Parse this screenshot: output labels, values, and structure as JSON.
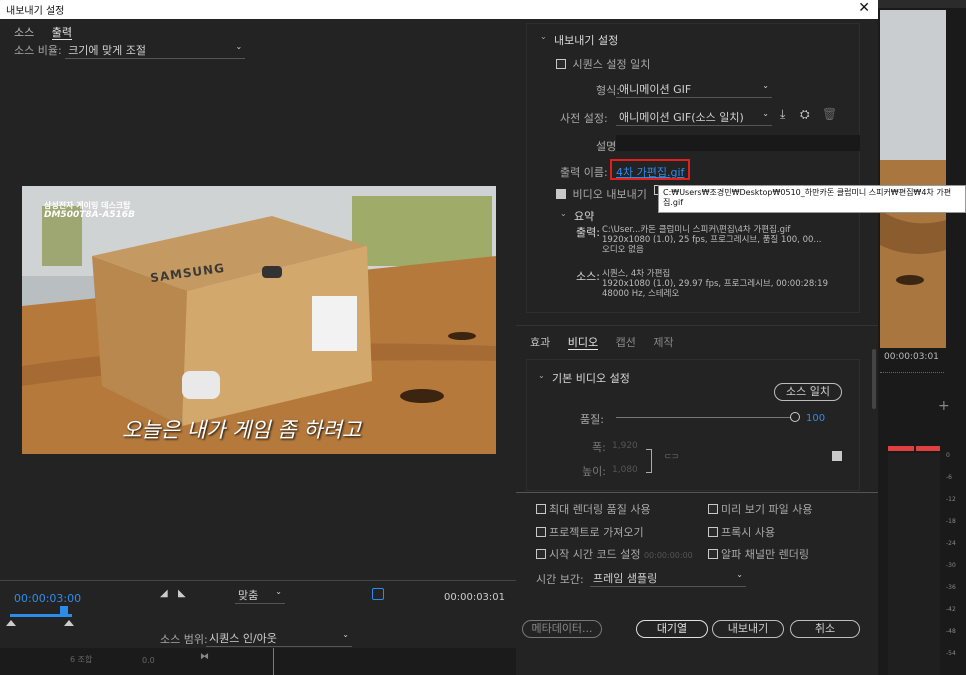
{
  "window": {
    "title": "내보내기 설정"
  },
  "left": {
    "tabs": [
      "소스",
      "출력"
    ],
    "source_scale_label": "소스 비율:",
    "source_scale_value": "크기에 맞게 조절",
    "video_caption_brand": "삼성전자 게이밍 데스크탑",
    "video_caption_model": "DM500T8A-A516B",
    "video_subtitle": "오늘은 내가 게임 좀 하려고",
    "box_brand": "SAMSUNG",
    "timecode_current": "00:00:03:00",
    "timecode_end": "00:00:03:01",
    "fit_label": "맞춤",
    "source_range_label": "소스 범위:",
    "source_range_value": "시퀀스 인/아웃"
  },
  "export": {
    "section_title": "내보내기 설정",
    "match_sequence_label": "시퀀스 설정 일치",
    "format_label": "형식:",
    "format_value": "애니메이션 GIF",
    "preset_label": "사전 설정:",
    "preset_value": "애니메이션 GIF(소스 일치)",
    "description_label": "설명:",
    "output_name_label": "출력 이름:",
    "output_name_value": "4차 가편집.gif",
    "export_video_label": "비디오 내보내기",
    "tooltip": "C:₩Users₩조경민₩Desktop₩0510_하만카돈 클럽미니 스피커₩편집₩4차 가편집.gif",
    "summary_title": "요약",
    "output_label": "출력:",
    "output_lines": [
      "C:\\User...카돈 클럽미니 스피커\\편집\\4차 가편집.gif",
      "1920x1080 (1.0), 25 fps, 프로그레시브, 품질 100, 00...",
      "오디오 없음"
    ],
    "source_label": "소스:",
    "source_lines": [
      "시퀀스, 4차 가편집",
      "1920x1080 (1.0), 29.97 fps, 프로그레시브, 00:00:28:19",
      "48000 Hz, 스테레오"
    ]
  },
  "subtabs": [
    "효과",
    "비디오",
    "캡션",
    "제작"
  ],
  "video": {
    "section_title": "기본 비디오 설정",
    "match_source_button": "소스 일치",
    "quality_label": "품질:",
    "quality_value": "100",
    "quality_fraction": 1.0,
    "width_label": "폭:",
    "width_value": "1,920",
    "height_label": "높이:",
    "height_value": "1,080"
  },
  "options": {
    "max_render": "최대 렌더링 품질 사용",
    "use_preview": "미리 보기 파일 사용",
    "import_project": "프로젝트로 가져오기",
    "use_proxy": "프록시 사용",
    "start_timecode": "시작 시간 코드 설정",
    "start_timecode_value": "00:00:00:00",
    "alpha_render": "알파 채널만 렌더링",
    "interpolation_label": "시간 보간:",
    "interpolation_value": "프레임 샘플링"
  },
  "buttons": {
    "metadata": "메타데이터...",
    "queue": "대기열",
    "export": "내보내기",
    "cancel": "취소"
  },
  "bg": {
    "timecode": "00:00:03:01",
    "plus": "+",
    "meter_labels": [
      "0",
      "-6",
      "-12",
      "-18",
      "-24",
      "-30",
      "-36",
      "-42",
      "-48",
      "-54"
    ],
    "bottom_left_label": "6 조합",
    "bottom_left_value": "0.0"
  },
  "colors": {
    "accent_blue": "#2d8ceb",
    "highlight_red": "#e0201b",
    "panel": "#232323"
  }
}
